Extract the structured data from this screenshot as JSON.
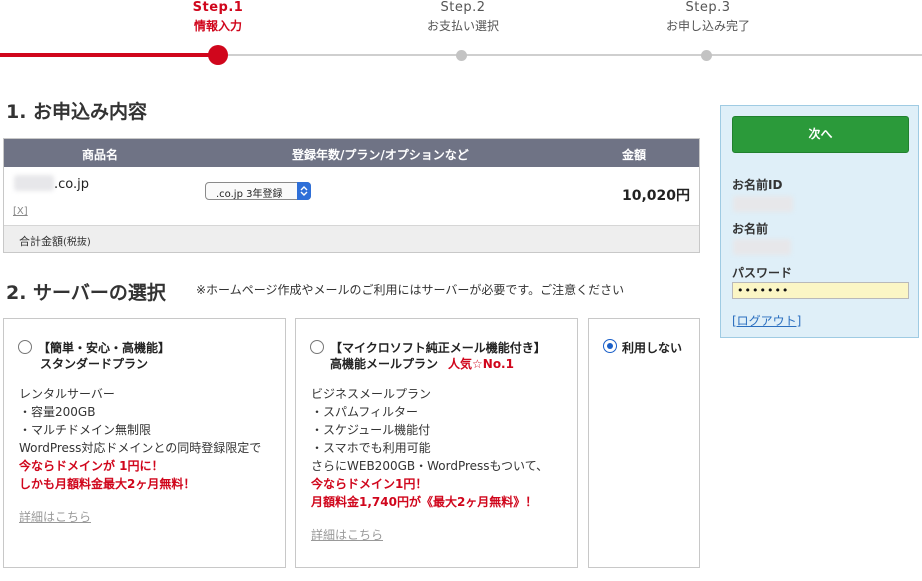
{
  "steps": [
    {
      "num": "Step.1",
      "label": "情報入力",
      "active": true
    },
    {
      "num": "Step.2",
      "label": "お支払い選択",
      "active": false
    },
    {
      "num": "Step.3",
      "label": "お申し込み完了",
      "active": false
    }
  ],
  "section1": {
    "title": "1. お申込み内容"
  },
  "order_table": {
    "headers": {
      "product": "商品名",
      "plan": "登録年数/プラン/オプションなど",
      "price": "金額"
    },
    "row": {
      "domain": ".co.jp",
      "remove": "[X]",
      "plan_value": ".co.jp 3年登録",
      "price": "10,020円"
    },
    "total_label": "合計金額",
    "total_note": "(税抜)"
  },
  "section2": {
    "title": "2. サーバーの選択",
    "note": "※ホームページ作成やメールのご利用にはサーバーが必要です。ご注意ください"
  },
  "cards": [
    {
      "title_line1": "【簡単・安心・高機能】",
      "title_line2": "スタンダードプラン",
      "features": [
        "レンタルサーバー",
        "・容量200GB",
        "・マルチドメイン無制限",
        "WordPress対応ドメインとの同時登録限定で"
      ],
      "promo": [
        "今ならドメインが 1円に！",
        "しかも月額料金最大2ヶ月無料！"
      ],
      "details": "詳細はこちら"
    },
    {
      "title_line1": "【マイクロソフト純正メール機能付き】",
      "title_line2": "高機能メールプラン",
      "badge": "人気☆No.1",
      "features": [
        "ビジネスメールプラン",
        "・スパムフィルター",
        "・スケジュール機能付",
        "・スマホでも利用可能",
        "さらにWEB200GB・WordPressもついて、"
      ],
      "promo": [
        "今ならドメイン1円！",
        "月額料金1,740円が《最大2ヶ月無料》！"
      ],
      "details": "詳細はこちら"
    },
    {
      "label": "利用しない",
      "selected": true
    }
  ],
  "side": {
    "next_button": "次へ",
    "id_label": "お名前ID",
    "name_label": "お名前",
    "password_label": "パスワード",
    "password_value": "•••••••",
    "logout": "[ログアウト]"
  },
  "colors": {
    "accent_red": "#d0061c",
    "next_green": "#2b9a3a",
    "table_header": "#6f7385",
    "side_panel": "#dfeff8"
  }
}
